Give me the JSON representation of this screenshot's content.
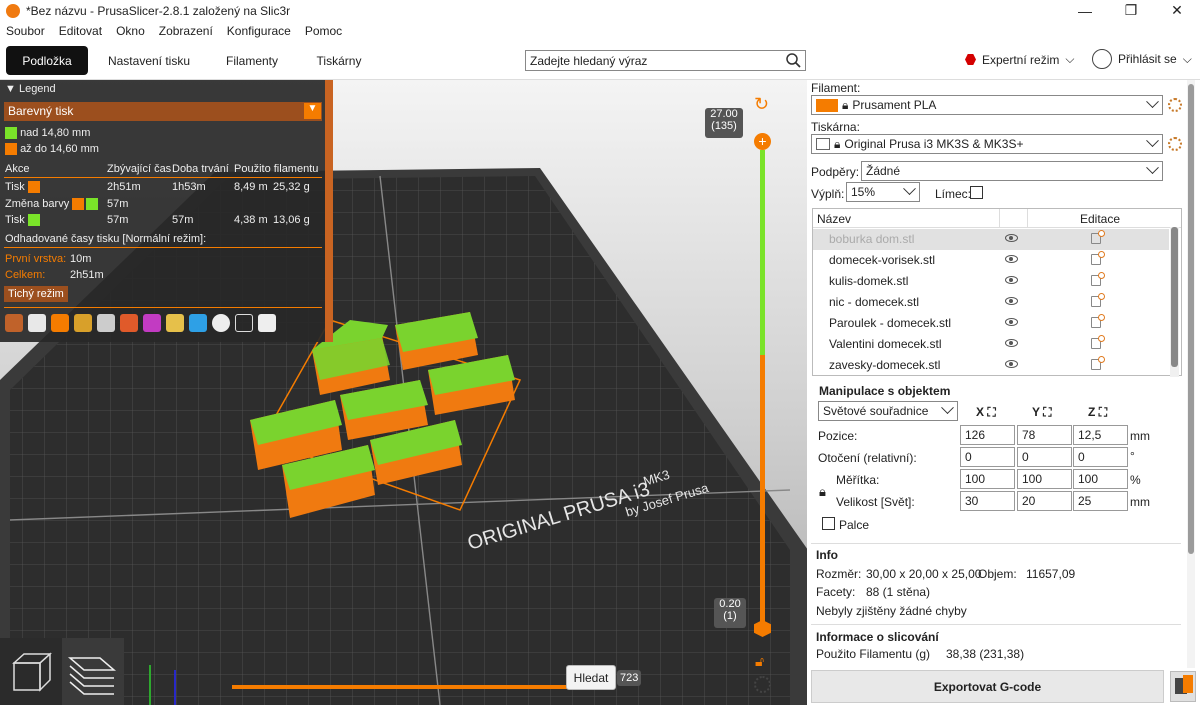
{
  "window": {
    "title": "*Bez názvu - PrusaSlicer-2.8.1 založený na Slic3r"
  },
  "menu": [
    "Soubor",
    "Editovat",
    "Okno",
    "Zobrazení",
    "Konfigurace",
    "Pomoc"
  ],
  "tabs": [
    {
      "label": "Podložka",
      "active": true
    },
    {
      "label": "Nastavení tisku",
      "active": false
    },
    {
      "label": "Filamenty",
      "active": false
    },
    {
      "label": "Tiskárny",
      "active": false
    }
  ],
  "search": {
    "placeholder": "Zadejte hledaný výraz"
  },
  "mode": {
    "label": "Expertní režim",
    "color": "#d40000"
  },
  "login": {
    "label": "Přihlásit se"
  },
  "legend": {
    "title": "Legend",
    "view_type": "Barevný tisk",
    "ranges": [
      {
        "label": "nad 14,80 mm",
        "color": "#7ae329"
      },
      {
        "label": "až do 14,60 mm",
        "color": "#f57c00"
      }
    ],
    "headers": [
      "Akce",
      "Zbývající čas",
      "Doba trvání",
      "Použito filamentu"
    ],
    "rows": [
      {
        "action": "Tisk",
        "color": "#f57c00",
        "remaining": "2h51m",
        "duration": "1h53m",
        "length": "8,49 m",
        "weight": "25,32 g"
      },
      {
        "action": "Změna barvy",
        "remaining": "57m"
      },
      {
        "action": "Tisk",
        "color": "#7ae329",
        "remaining": "57m",
        "duration": "57m",
        "length": "4,38 m",
        "weight": "13,06 g"
      }
    ],
    "estimate_title": "Odhadované časy tisku [Normální režim]:",
    "first_layer_label": "První vrstva:",
    "first_layer_value": "10m",
    "total_label": "Celkem:",
    "total_value": "2h51m",
    "quiet_mode": "Tichý režim"
  },
  "bed": {
    "brand_line1": "ORIGINAL PRUSA i3",
    "brand_model": "MK3",
    "brand_line2": "by Josef Prusa"
  },
  "layer_slider": {
    "top_value": "27.00",
    "top_layer": "(135)",
    "bottom_value": "0.20",
    "bottom_layer": "(1)"
  },
  "horizontal_slider": {
    "tooltip": "Hledat",
    "value": "723"
  },
  "right_panel": {
    "filament_label": "Filament:",
    "filament_value": "Prusament PLA",
    "filament_color": "#f57c00",
    "printer_label": "Tiskárna:",
    "printer_value": "Original Prusa i3 MK3S & MK3S+",
    "supports_label": "Podpěry:",
    "supports_value": "Žádné",
    "infill_label": "Výplň:",
    "infill_value": "15%",
    "brim_label": "Límec:",
    "list_header_name": "Název",
    "list_header_edit": "Editace",
    "objects": [
      "boburka dom.stl",
      "domecek-vorisek.stl",
      "kulis-domek.stl",
      "nic - domecek.stl",
      "Paroulek - domecek.stl",
      "Valentini domecek.stl",
      "zavesky-domecek.stl"
    ],
    "manip_title": "Manipulace s objektem",
    "coord_system": "Světové souřadnice",
    "axes": [
      "X",
      "Y",
      "Z"
    ],
    "position_label": "Pozice:",
    "position": [
      "126",
      "78",
      "12,5"
    ],
    "position_unit": "mm",
    "rotation_label": "Otočení (relativní):",
    "rotation": [
      "0",
      "0",
      "0"
    ],
    "rotation_unit": "°",
    "scale_label": "Měřítka:",
    "scale": [
      "100",
      "100",
      "100"
    ],
    "scale_unit": "%",
    "size_label": "Velikost [Svět]:",
    "size": [
      "30",
      "20",
      "25"
    ],
    "size_unit": "mm",
    "inches_label": "Palce",
    "info_title": "Info",
    "size_info_label": "Rozměr:",
    "size_info_value": "30,00 x 20,00 x 25,00",
    "volume_label": "Objem:",
    "volume_value": "11657,09",
    "facets_label": "Facety:",
    "facets_value": "88 (1 stěna)",
    "errors_text": "Nebyly zjištěny žádné chyby",
    "slice_info_title": "Informace o slicování",
    "filament_used_label": "Použito Filamentu (g)",
    "filament_used_value": "38,38 (231,38)",
    "export_label": "Exportovat G-code"
  }
}
